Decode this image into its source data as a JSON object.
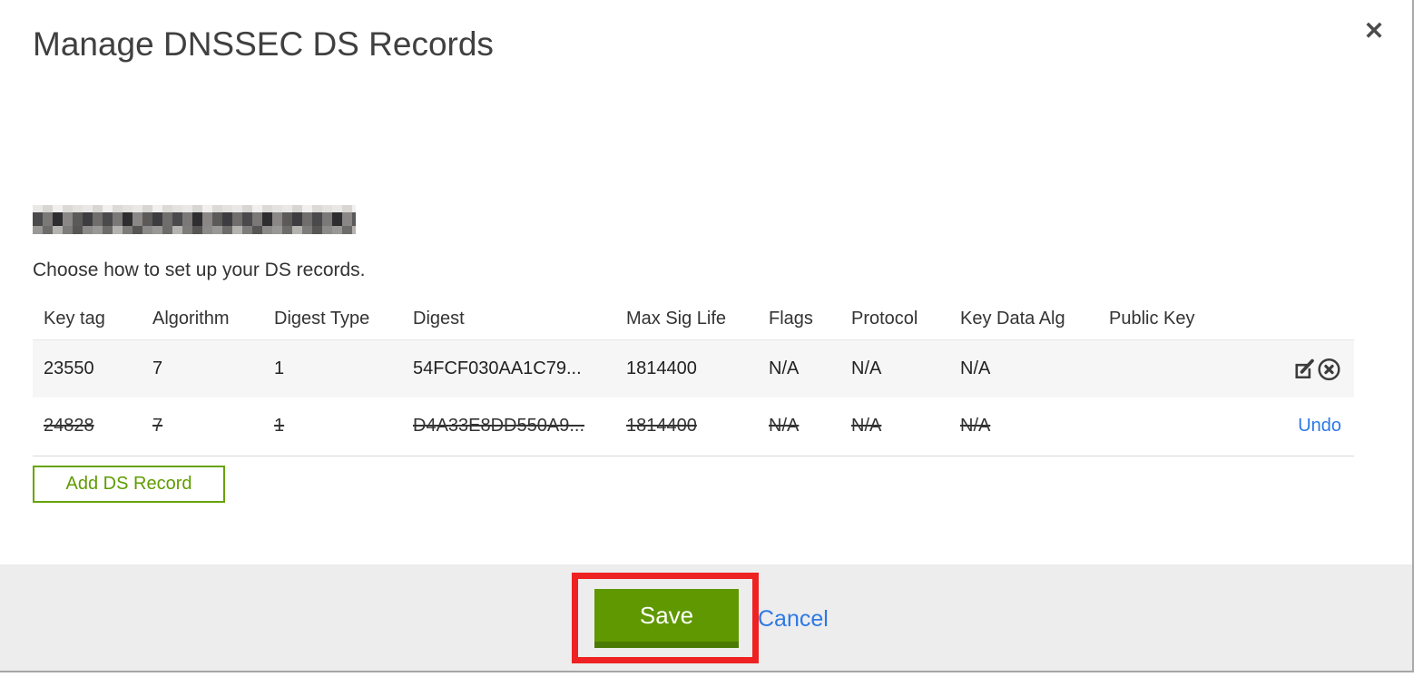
{
  "window": {
    "title": "Manage DNSSEC DS Records",
    "close_icon": "✕"
  },
  "domain": {
    "redacted": true
  },
  "instruction": "Choose how to set up your DS records.",
  "table": {
    "headers": [
      "Key tag",
      "Algorithm",
      "Digest Type",
      "Digest",
      "Max Sig Life",
      "Flags",
      "Protocol",
      "Key Data Alg",
      "Public Key"
    ],
    "rows": [
      {
        "key_tag": "23550",
        "algorithm": "7",
        "digest_type": "1",
        "digest": "54FCF030AA1C79...",
        "max_sig_life": "1814400",
        "flags": "N/A",
        "protocol": "N/A",
        "key_data_alg": "N/A",
        "public_key": "",
        "state": "active",
        "actions": [
          "edit",
          "delete"
        ]
      },
      {
        "key_tag": "24828",
        "algorithm": "7",
        "digest_type": "1",
        "digest": "D4A33E8DD550A9...",
        "max_sig_life": "1814400",
        "flags": "N/A",
        "protocol": "N/A",
        "key_data_alg": "N/A",
        "public_key": "",
        "state": "deleted",
        "action_label": "Undo"
      }
    ]
  },
  "buttons": {
    "add_ds_record": "Add DS Record",
    "save": "Save",
    "cancel": "Cancel"
  },
  "icons": {
    "edit": "pencil-on-square",
    "delete": "x-in-circle",
    "close": "x-mark"
  },
  "colors": {
    "brand_green": "#5f9800",
    "brand_green_dark": "#4a7a04",
    "green_border": "#67a303",
    "link_blue": "#2d79e5",
    "annotation_red": "#ee2222",
    "row_alt_bg": "#f6f6f6",
    "footer_bg": "#ededed"
  }
}
